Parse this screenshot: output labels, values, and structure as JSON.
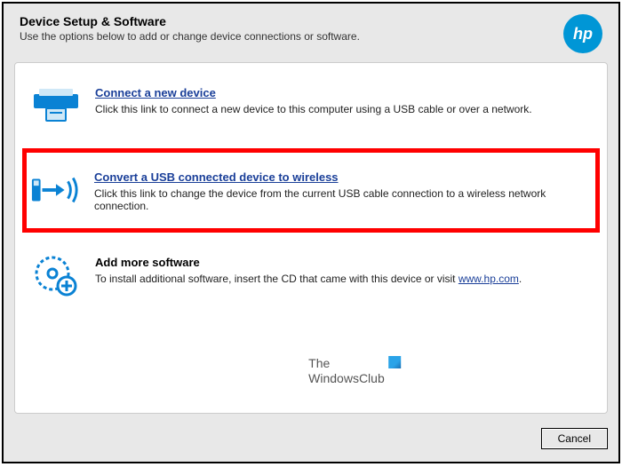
{
  "header": {
    "title": "Device Setup & Software",
    "subtitle": "Use the options below to add or change device connections or software.",
    "logo_text": "hp"
  },
  "options": {
    "connect": {
      "title": "Connect a new device",
      "desc": "Click this link to connect a new device to this computer using a USB cable or over a network."
    },
    "convert": {
      "title": "Convert a USB connected device to wireless",
      "desc": "Click this link to change the device from the current USB cable connection to a wireless network connection."
    },
    "addmore": {
      "title": "Add more software",
      "desc_prefix": "To install additional software, insert the CD that came with this device or visit ",
      "link_text": "www.hp.com",
      "desc_suffix": "."
    }
  },
  "watermark": {
    "line1": "The",
    "line2": "WindowsClub"
  },
  "footer": {
    "cancel": "Cancel"
  }
}
